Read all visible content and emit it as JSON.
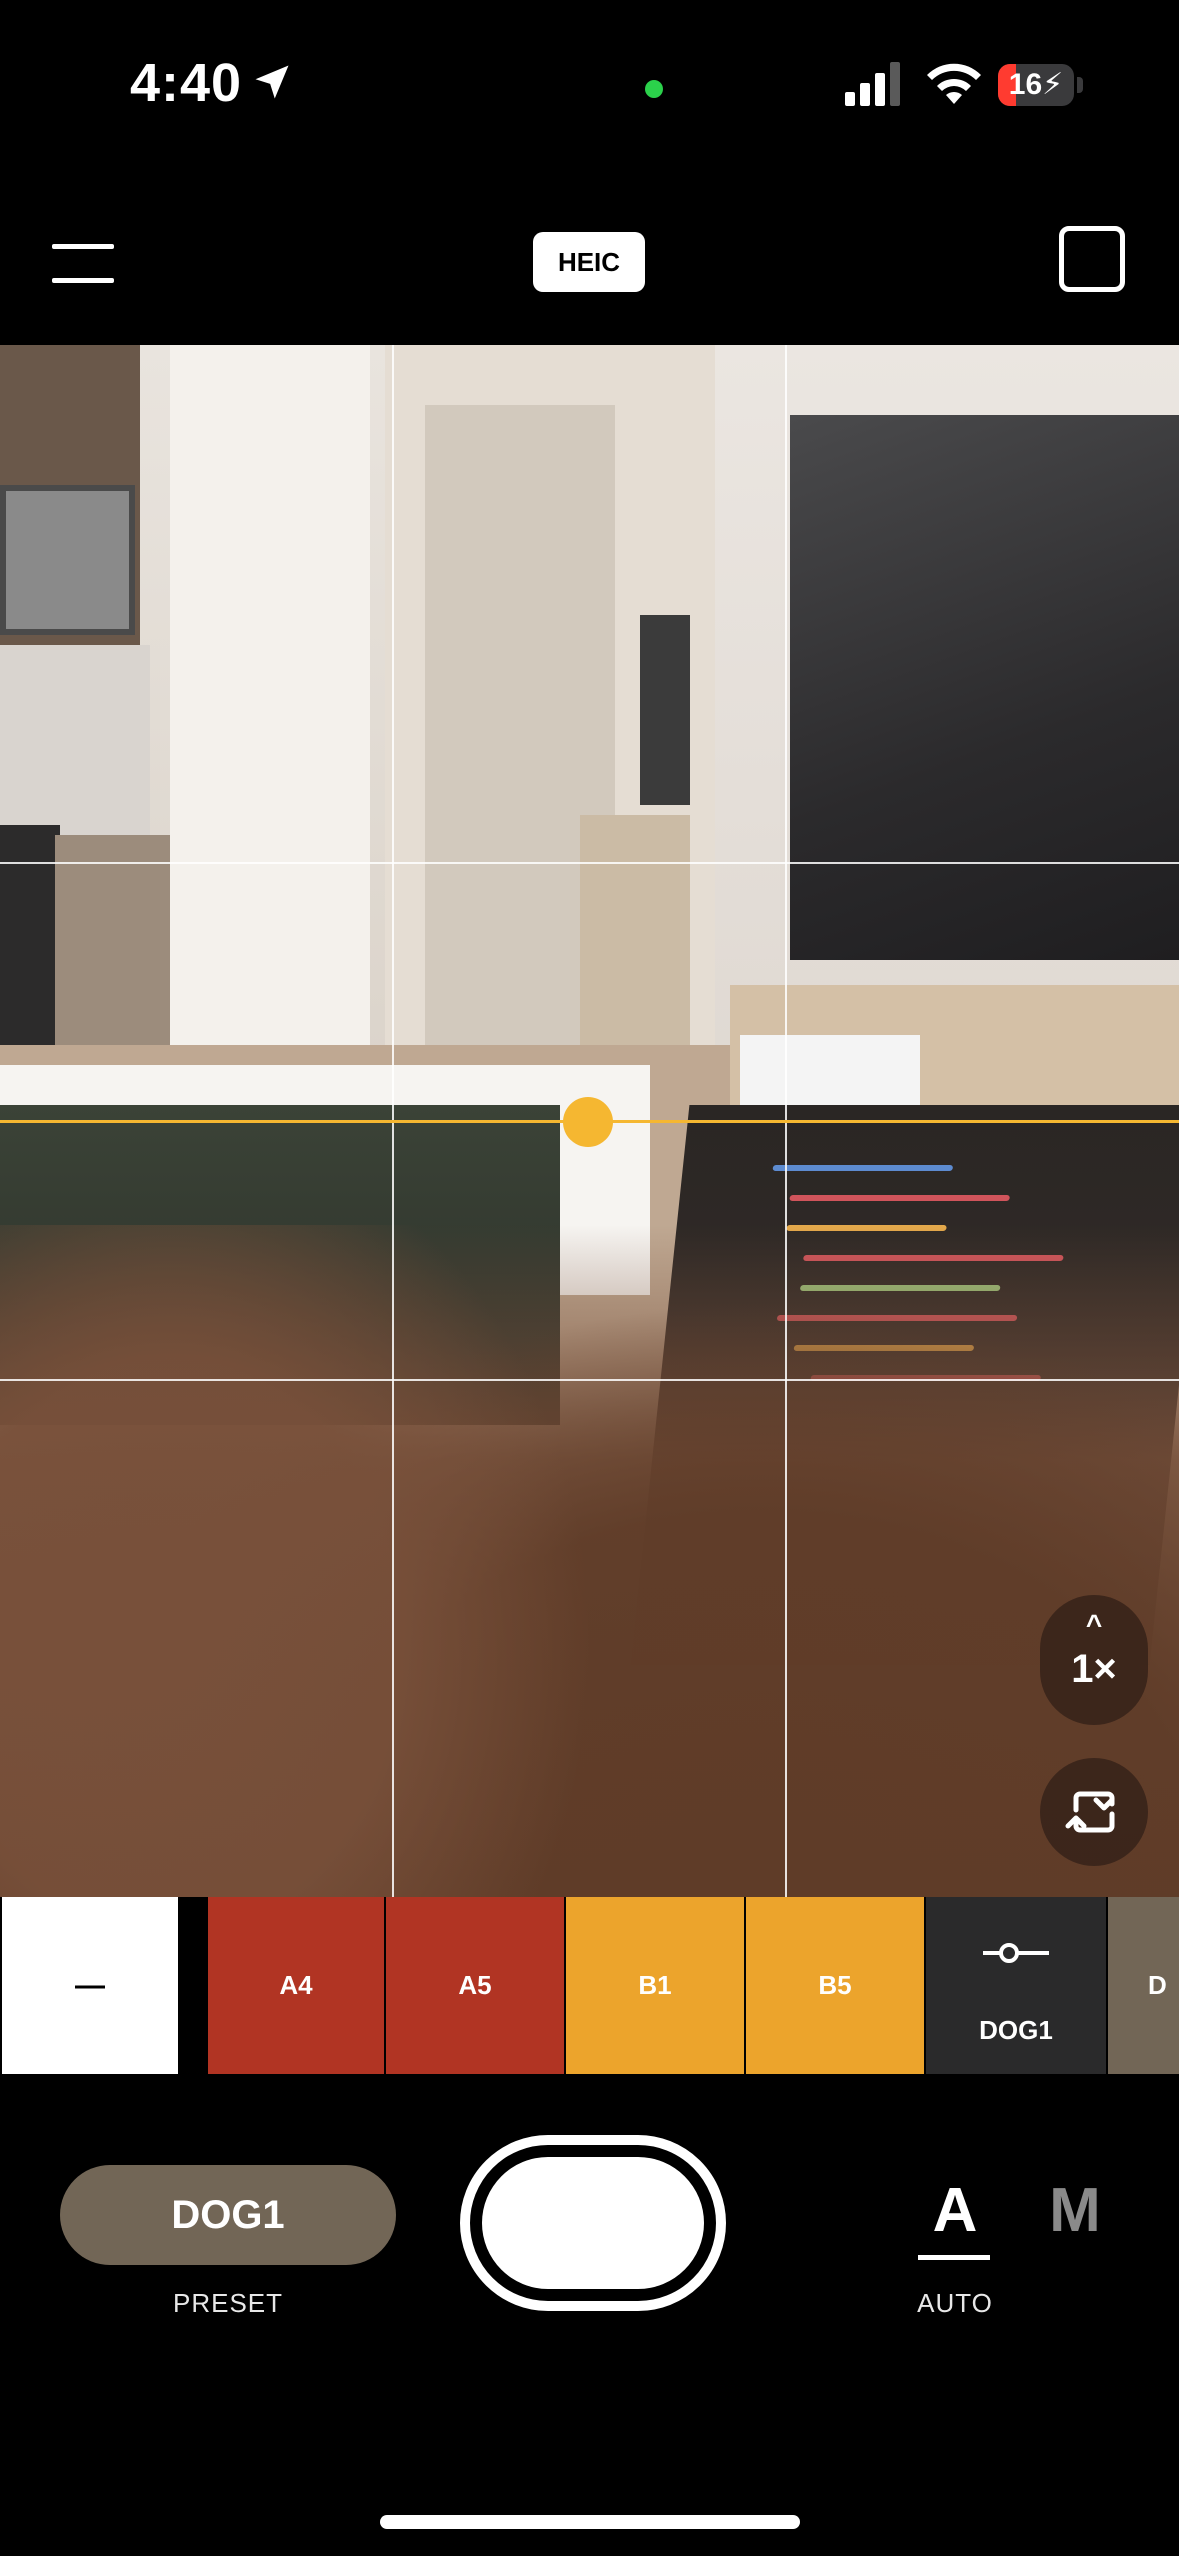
{
  "status_bar": {
    "time": "4:40",
    "battery_level": "16",
    "icons": [
      "location-arrow-icon",
      "camera-in-use-dot",
      "cellular-signal-icon",
      "wifi-icon",
      "battery-charging-icon"
    ]
  },
  "toolbar": {
    "menu_icon": "hamburger-menu-icon",
    "format_label": "HEIC",
    "aspect_icon": "square-frame-icon"
  },
  "viewfinder": {
    "grid": "3x3",
    "level_indicator_color": "#f5b731",
    "zoom_caret": "^",
    "zoom_label": "1×",
    "flip_icon": "flip-camera-icon"
  },
  "presets": {
    "items": [
      {
        "label": "—",
        "color": "#ffffff"
      },
      {
        "label": "A4",
        "color": "#b13423"
      },
      {
        "label": "A5",
        "color": "#b13423"
      },
      {
        "label": "B1",
        "color": "#eca42c"
      },
      {
        "label": "B5",
        "color": "#eca42c"
      },
      {
        "label": "DOG1",
        "color": "#2a2a2b",
        "icon": "slider-adjust-icon"
      },
      {
        "label": "D",
        "color": "#726656"
      }
    ]
  },
  "bottom": {
    "preset_value": "DOG1",
    "preset_caption": "PRESET",
    "mode_auto": "A",
    "mode_manual": "M",
    "mode_caption": "AUTO"
  }
}
